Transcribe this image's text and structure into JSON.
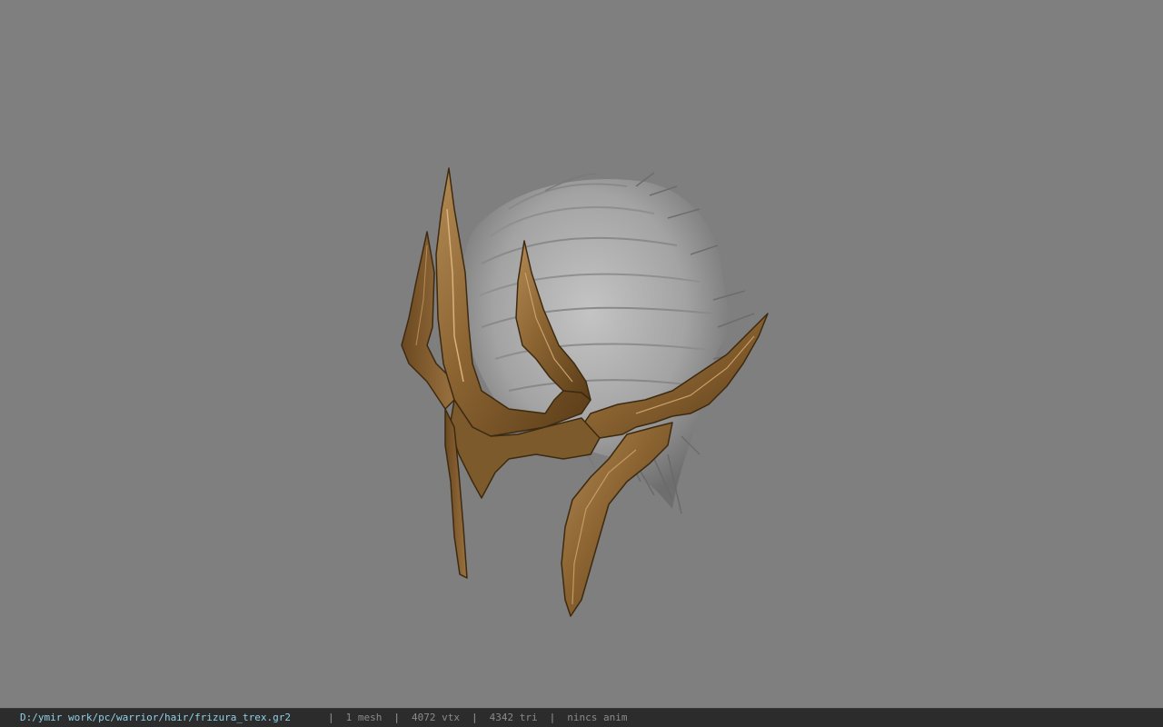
{
  "viewer": {
    "background_color": "#7f7f7f",
    "model_name": "frizura_trex"
  },
  "statusbar": {
    "file_path": "D:/ymir work/pc/warrior/hair/frizura_trex.gr2",
    "mesh_count": "1 mesh",
    "vertex_count": "4072 vtx",
    "triangle_count": "4342 tri",
    "anim_status": "nincs anim",
    "separator": "|",
    "path_color": "#8fd0e8",
    "text_color": "#8a8a8a"
  }
}
